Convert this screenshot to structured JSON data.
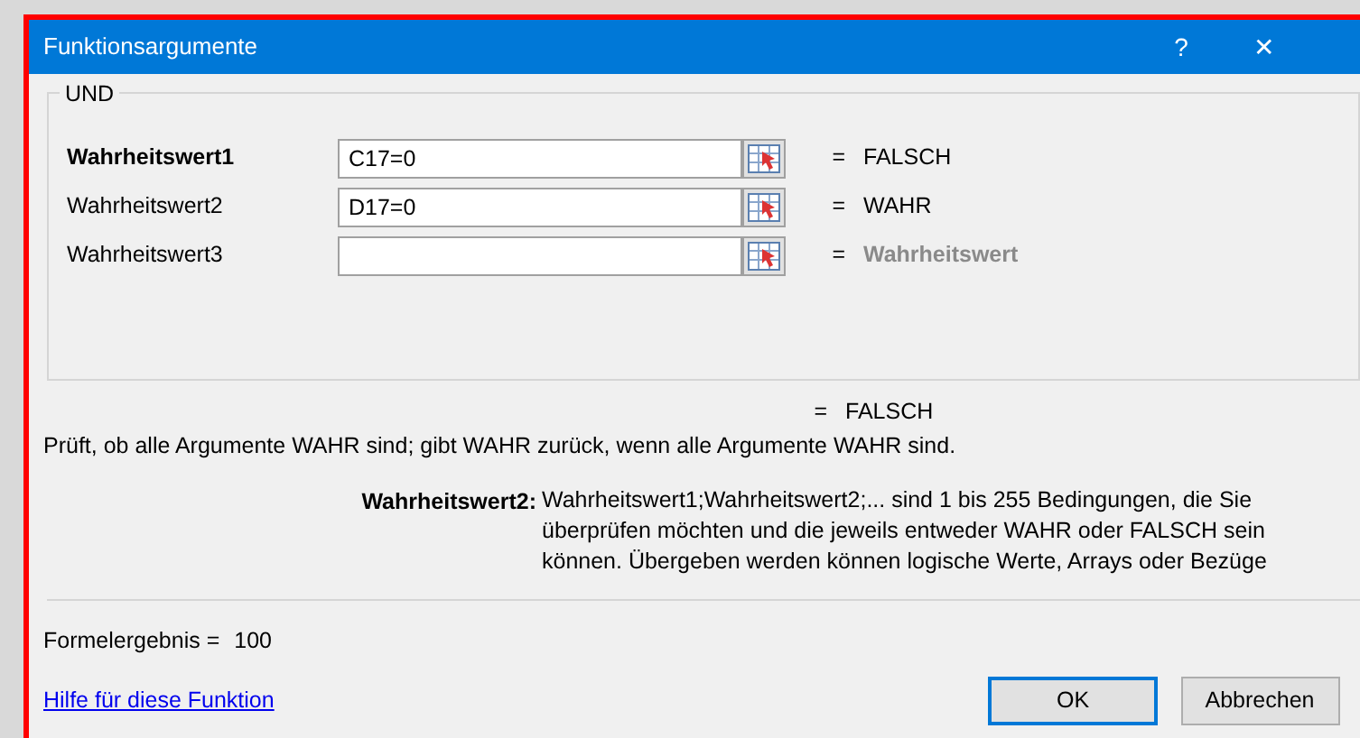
{
  "window": {
    "title": "Funktionsargumente",
    "controls": [
      "?",
      "✕"
    ]
  },
  "function_name": "UND",
  "arguments": [
    {
      "label": "Wahrheitswert1",
      "active": true,
      "value": "C17=0",
      "result": "FALSCH",
      "kind": "value"
    },
    {
      "label": "Wahrheitswert2",
      "active": false,
      "value": "D17=0",
      "result": "WAHR",
      "kind": "value"
    },
    {
      "label": "Wahrheitswert3",
      "active": false,
      "result": "Wahrheitswert",
      "kind": "hint"
    }
  ],
  "equals": "=",
  "total_result": "FALSCH",
  "description": "Prüft, ob alle Argumente WAHR sind; gibt WAHR zurück, wenn alle Argumente WAHR sind.",
  "argument_help": {
    "label": "Wahrheitswert2:",
    "text": "Wahrheitswert1;Wahrheitswert2;... sind 1 bis 255 Bedingungen, die Sie überprüfen möchten und die jeweils entweder WAHR oder FALSCH sein können. Übergeben werden können logische Werte, Arrays oder Bezüge"
  },
  "formula_result": {
    "label": "Formelergebnis =",
    "value": "100"
  },
  "help_link": "Hilfe für diese Funktion",
  "buttons": [
    {
      "label": "OK",
      "default": true
    },
    {
      "label": "Abbrechen",
      "default": false
    }
  ]
}
